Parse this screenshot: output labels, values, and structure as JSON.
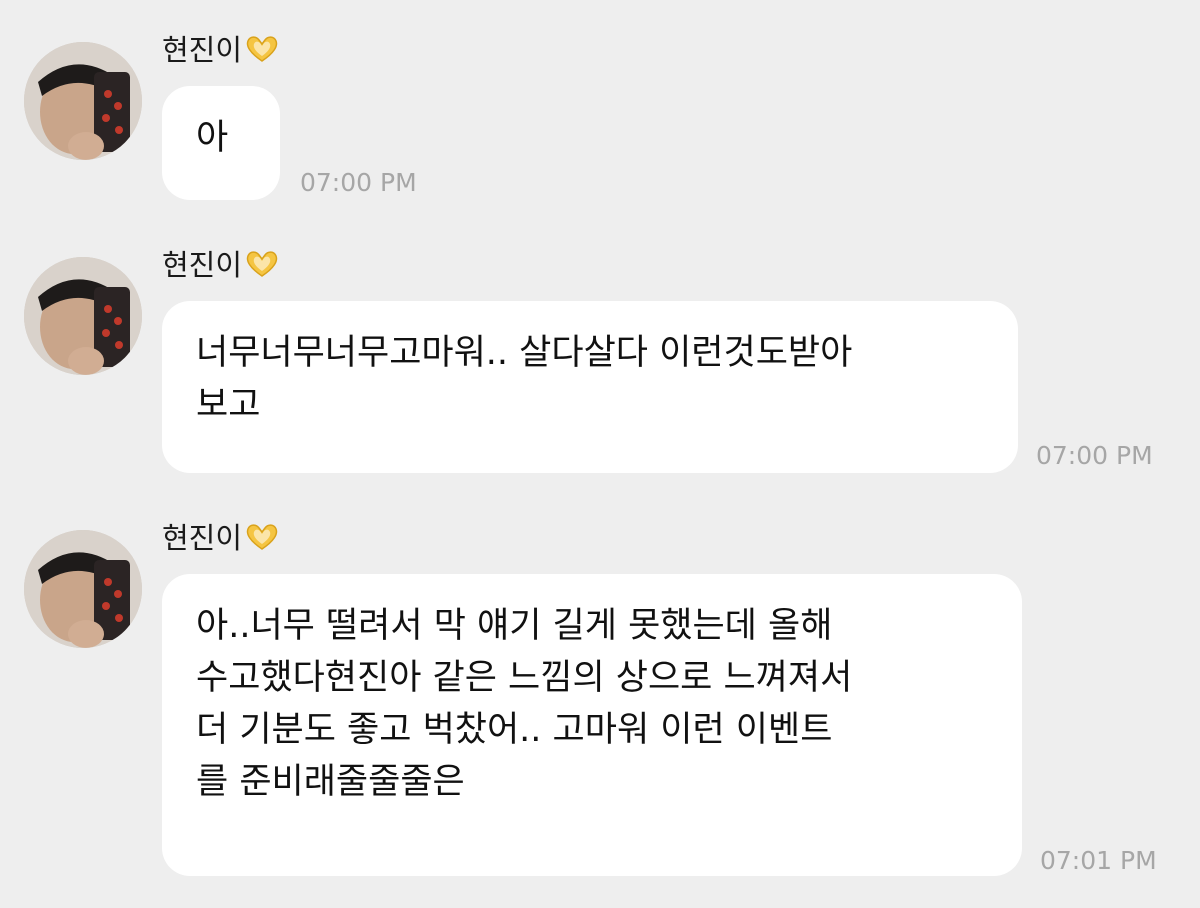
{
  "messages": [
    {
      "sender": "현진이",
      "lines": [
        "아"
      ],
      "time": "07:00 PM"
    },
    {
      "sender": "현진이",
      "lines": [
        "너무너무너무고마워.. 살다살다 이런것도받아",
        "보고"
      ],
      "time": "07:00 PM"
    },
    {
      "sender": "현진이",
      "lines": [
        "아..너무 떨려서 막 얘기 길게 못했는데 올해",
        "수고했다현진아 같은 느낌의 상으로 느껴져서",
        "더 기분도 좋고 벅찼어.. 고마워 이런 이벤트",
        "를 준비래줄줄줄은"
      ],
      "time": "07:01 PM"
    }
  ],
  "icons": {
    "sender_badge": "heart-hands-icon",
    "avatar": "avatar"
  },
  "colors": {
    "background": "#eeeeee",
    "bubble": "#ffffff",
    "timestamp": "#a6a6a6",
    "heart": "#f5c542"
  }
}
